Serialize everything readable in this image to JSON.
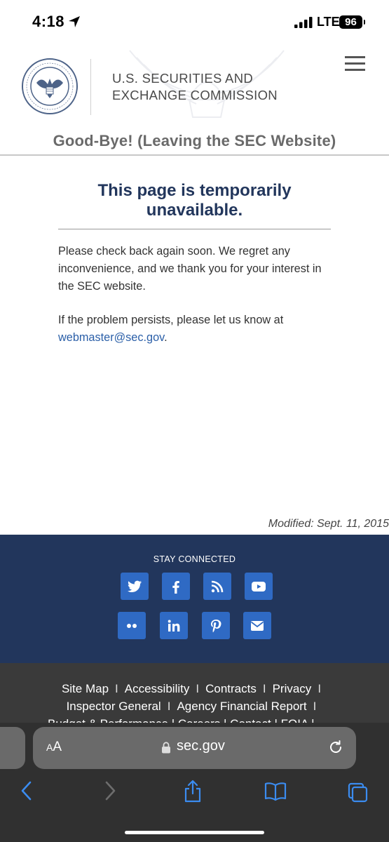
{
  "status_bar": {
    "time": "4:18",
    "network": "LTE",
    "battery": "96"
  },
  "header": {
    "agency_line1": "U.S. SECURITIES AND",
    "agency_line2": "EXCHANGE COMMISSION",
    "banner": "Good-Bye! (Leaving the SEC Website)",
    "seal_text": "U.S. SECURITIES AND EXCHANGE COMMISSION MCMXXXIV"
  },
  "main": {
    "heading_line1": "This page is temporarily",
    "heading_line2": "unavailable.",
    "paragraph1": "Please check back again soon. We regret any inconvenience, and we thank you for your interest in the SEC website.",
    "paragraph2_prefix": "If the problem persists, please let us know at",
    "email": "webmaster@sec.gov",
    "paragraph2_suffix": ".",
    "modified": "Modified: Sept. 11, 2015"
  },
  "stay_connected": {
    "label": "STAY CONNECTED",
    "icons": [
      "twitter-icon",
      "facebook-icon",
      "rss-icon",
      "youtube-icon",
      "flickr-icon",
      "linkedin-icon",
      "pinterest-icon",
      "email-icon"
    ],
    "accent_color": "#2f6ac4",
    "background_color": "#22365c"
  },
  "footer": {
    "links_row1": [
      "Site Map",
      "Accessibility",
      "Contracts",
      "Privacy"
    ],
    "links_row2": [
      "Inspector General",
      "Agency Financial Report"
    ],
    "row3_partial": "Budget & Performance  |  Careers  |  Contact  |  FOIA  |"
  },
  "safari": {
    "aa_small": "A",
    "aa_large": "A",
    "url": "sec.gov"
  }
}
